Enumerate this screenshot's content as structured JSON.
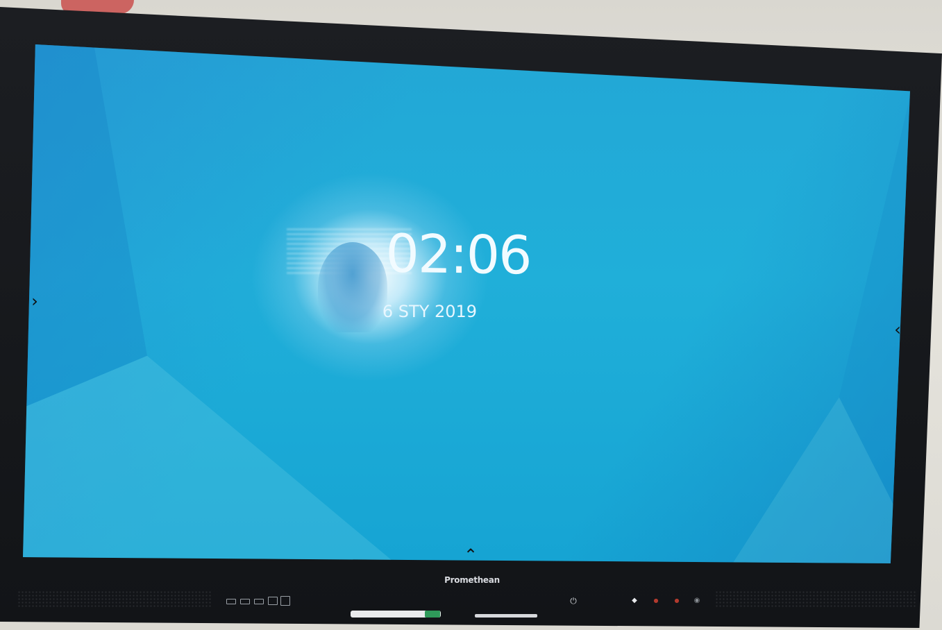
{
  "screen": {
    "time": "02:06",
    "date": "6 STY 2019"
  },
  "edge_controls": {
    "left_arrow": "›",
    "right_arrow": "‹",
    "bottom_arrow": "⌃"
  },
  "bezel": {
    "brand": "Promethean",
    "buttons": {
      "power": "⏻",
      "home": "◆",
      "volume_down": "●",
      "volume_up": "●",
      "camera": "◉"
    }
  },
  "colors": {
    "wallpaper": "#20afd9",
    "bezel": "#141619",
    "clock_text": "#f2fbff"
  },
  "icons": [
    "chevron-right-icon",
    "chevron-left-icon",
    "chevron-up-icon",
    "power-icon",
    "home-icon",
    "volume-icon",
    "camera-icon"
  ]
}
